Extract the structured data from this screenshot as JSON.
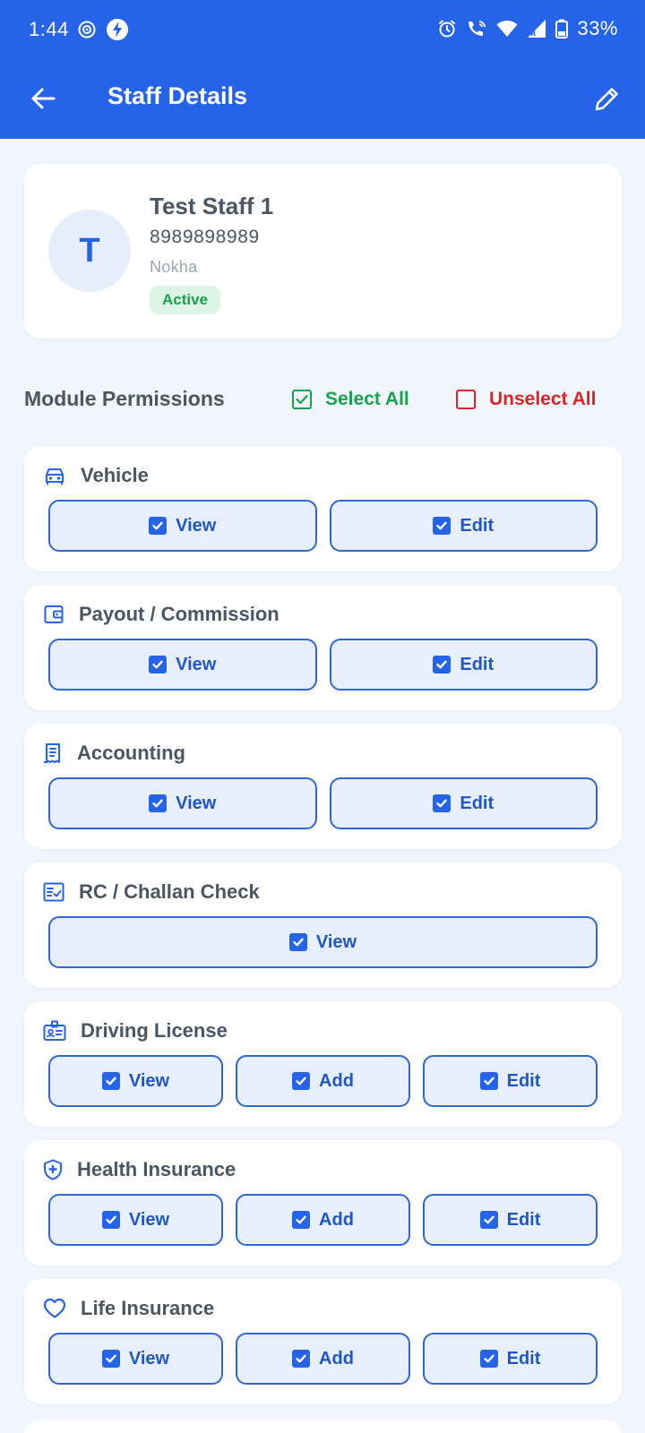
{
  "status_bar": {
    "time": "1:44",
    "battery": "33%"
  },
  "header": {
    "title": "Staff Details"
  },
  "profile": {
    "initial": "T",
    "name": "Test Staff 1",
    "phone": "8989898989",
    "location": "Nokha",
    "status": "Active"
  },
  "permissions": {
    "title": "Module Permissions",
    "select_all": "Select All",
    "unselect_all": "Unselect All"
  },
  "modules": [
    {
      "name": "Vehicle",
      "icon": "car-icon",
      "actions": [
        {
          "label": "View",
          "checked": true
        },
        {
          "label": "Edit",
          "checked": true
        }
      ]
    },
    {
      "name": "Payout / Commission",
      "icon": "wallet-icon",
      "actions": [
        {
          "label": "View",
          "checked": true
        },
        {
          "label": "Edit",
          "checked": true
        }
      ]
    },
    {
      "name": "Accounting",
      "icon": "receipt-icon",
      "actions": [
        {
          "label": "View",
          "checked": true
        },
        {
          "label": "Edit",
          "checked": true
        }
      ]
    },
    {
      "name": "RC / Challan Check",
      "icon": "checklist-icon",
      "actions": [
        {
          "label": "View",
          "checked": true
        }
      ]
    },
    {
      "name": "Driving License",
      "icon": "id-badge-icon",
      "actions": [
        {
          "label": "View",
          "checked": true
        },
        {
          "label": "Add",
          "checked": true
        },
        {
          "label": "Edit",
          "checked": true
        }
      ]
    },
    {
      "name": "Health Insurance",
      "icon": "shield-plus-icon",
      "actions": [
        {
          "label": "View",
          "checked": true
        },
        {
          "label": "Add",
          "checked": true
        },
        {
          "label": "Edit",
          "checked": true
        }
      ]
    },
    {
      "name": "Life Insurance",
      "icon": "heart-icon",
      "actions": [
        {
          "label": "View",
          "checked": true
        },
        {
          "label": "Add",
          "checked": true
        },
        {
          "label": "Edit",
          "checked": true
        }
      ]
    }
  ],
  "colors": {
    "primary": "#2563e9",
    "success": "#16a34a",
    "danger": "#dc2626",
    "background": "#f1f5fd"
  }
}
